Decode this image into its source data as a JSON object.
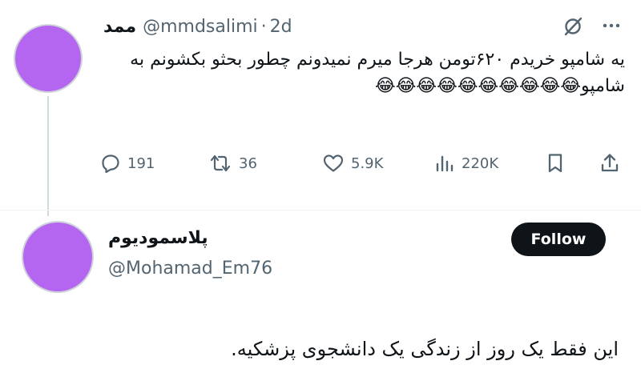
{
  "tweet": {
    "author_name": "ممد",
    "handle": "@mmdsalimi",
    "separator": "·",
    "time": "2d",
    "text": "یه شامپو خریدم ۶۲۰تومن هرجا میرم نمیدونم چطور بحثو بکشونم به شامپو😂😂😂😂😂😂😂😂😂😂",
    "replies": "191",
    "retweets": "36",
    "likes": "5.9K",
    "views": "220K"
  },
  "reply": {
    "author_name": "پلاسمودیوم",
    "handle": "@Mohamad_Em76",
    "follow_label": "Follow",
    "text": "این فقط یک روز از زندگی یک دانشجوی پزشکیه."
  },
  "icons": {
    "grok": "grok-icon",
    "more": "more-icon",
    "reply": "reply-icon",
    "retweet": "retweet-icon",
    "like": "heart-icon",
    "views": "views-icon",
    "bookmark": "bookmark-icon",
    "share": "share-icon"
  },
  "colors": {
    "text": "#0f1419",
    "secondary": "#536471",
    "avatar": "#b566f0",
    "follow_button": "#0f1419"
  }
}
